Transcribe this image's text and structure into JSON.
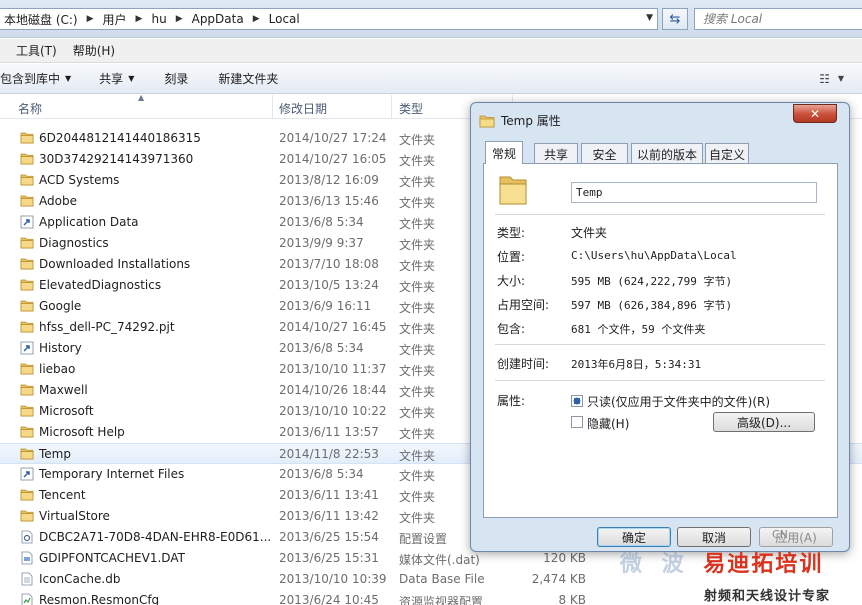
{
  "address": {
    "crumbs": [
      "本地磁盘 (C:)",
      "用户",
      "hu",
      "AppData",
      "Local"
    ],
    "search_placeholder": "搜索 Local"
  },
  "menu": [
    "工具(T)",
    "帮助(H)"
  ],
  "toolbar": {
    "include_label": "包含到库中",
    "share_label": "共享",
    "burn_label": "刻录",
    "new_folder_label": "新建文件夹"
  },
  "columns": {
    "name": "名称",
    "date": "修改日期",
    "type": "类型"
  },
  "files": [
    {
      "name": "6D2044812141440186315",
      "date": "2014/10/27 17:24",
      "type": "文件夹",
      "size": "",
      "icon": "folder"
    },
    {
      "name": "30D37429214143971360",
      "date": "2014/10/27 16:05",
      "type": "文件夹",
      "size": "",
      "icon": "folder"
    },
    {
      "name": "ACD Systems",
      "date": "2013/8/12 16:09",
      "type": "文件夹",
      "size": "",
      "icon": "folder"
    },
    {
      "name": "Adobe",
      "date": "2013/6/13 15:46",
      "type": "文件夹",
      "size": "",
      "icon": "folder"
    },
    {
      "name": "Application Data",
      "date": "2013/6/8 5:34",
      "type": "文件夹",
      "size": "",
      "icon": "shortcut"
    },
    {
      "name": "Diagnostics",
      "date": "2013/9/9 9:37",
      "type": "文件夹",
      "size": "",
      "icon": "folder"
    },
    {
      "name": "Downloaded Installations",
      "date": "2013/7/10 18:08",
      "type": "文件夹",
      "size": "",
      "icon": "folder"
    },
    {
      "name": "ElevatedDiagnostics",
      "date": "2013/10/5 13:24",
      "type": "文件夹",
      "size": "",
      "icon": "folder"
    },
    {
      "name": "Google",
      "date": "2013/6/9 16:11",
      "type": "文件夹",
      "size": "",
      "icon": "folder"
    },
    {
      "name": "hfss_dell-PC_74292.pjt",
      "date": "2014/10/27 16:45",
      "type": "文件夹",
      "size": "",
      "icon": "folder"
    },
    {
      "name": "History",
      "date": "2013/6/8 5:34",
      "type": "文件夹",
      "size": "",
      "icon": "shortcut"
    },
    {
      "name": "liebao",
      "date": "2013/10/10 11:37",
      "type": "文件夹",
      "size": "",
      "icon": "folder"
    },
    {
      "name": "Maxwell",
      "date": "2014/10/26 18:44",
      "type": "文件夹",
      "size": "",
      "icon": "folder"
    },
    {
      "name": "Microsoft",
      "date": "2013/10/10 10:22",
      "type": "文件夹",
      "size": "",
      "icon": "folder"
    },
    {
      "name": "Microsoft Help",
      "date": "2013/6/11 13:57",
      "type": "文件夹",
      "size": "",
      "icon": "folder"
    },
    {
      "name": "Temp",
      "date": "2014/11/8 22:53",
      "type": "文件夹",
      "size": "",
      "icon": "folder",
      "selected": true
    },
    {
      "name": "Temporary Internet Files",
      "date": "2013/6/8 5:34",
      "type": "文件夹",
      "size": "",
      "icon": "shortcut"
    },
    {
      "name": "Tencent",
      "date": "2013/6/11 13:41",
      "type": "文件夹",
      "size": "",
      "icon": "folder"
    },
    {
      "name": "VirtualStore",
      "date": "2013/6/11 13:42",
      "type": "文件夹",
      "size": "",
      "icon": "folder"
    },
    {
      "name": "DCBC2A71-70D8-4DAN-EHR8-E0D61...",
      "date": "2013/6/25 15:54",
      "type": "配置设置",
      "size": "",
      "icon": "config-file"
    },
    {
      "name": "GDIPFONTCACHEV1.DAT",
      "date": "2013/6/25 15:31",
      "type": "媒体文件(.dat)",
      "size": "120 KB",
      "icon": "dat-file"
    },
    {
      "name": "IconCache.db",
      "date": "2013/10/10 10:39",
      "type": "Data Base File",
      "size": "2,474 KB",
      "icon": "db-file"
    },
    {
      "name": "Resmon.ResmonCfg",
      "date": "2013/6/24 10:45",
      "type": "资源监视器配置",
      "size": "8 KB",
      "icon": "cfg-file"
    }
  ],
  "dialog": {
    "title": "Temp 属性",
    "close_glyph": "✕",
    "tabs": [
      "常规",
      "共享",
      "安全",
      "以前的版本",
      "自定义"
    ],
    "folder_name": "Temp",
    "props": [
      {
        "label": "类型:",
        "value": "文件夹"
      },
      {
        "label": "位置:",
        "value": "C:\\Users\\hu\\AppData\\Local"
      },
      {
        "label": "大小:",
        "value": "595 MB (624,222,799 字节)"
      },
      {
        "label": "占用空间:",
        "value": "597 MB (626,384,896 字节)"
      },
      {
        "label": "包含:",
        "value": "681 个文件，59 个文件夹"
      }
    ],
    "created_label": "创建时间:",
    "created_value": "2013年6月8日，5:34:31",
    "attrs_label": "属性:",
    "readonly_label": "只读(仅应用于文件夹中的文件)(R)",
    "hidden_label": "隐藏(H)",
    "advanced_label": "高级(D)...",
    "ok_label": "确定",
    "cancel_label": "取消",
    "apply_label": "应用(A)"
  },
  "watermark": {
    "line1_a": "微 波",
    "line1_b": "易迪拓培训",
    "line2": "射频和天线设计专家",
    "url": "CN"
  }
}
